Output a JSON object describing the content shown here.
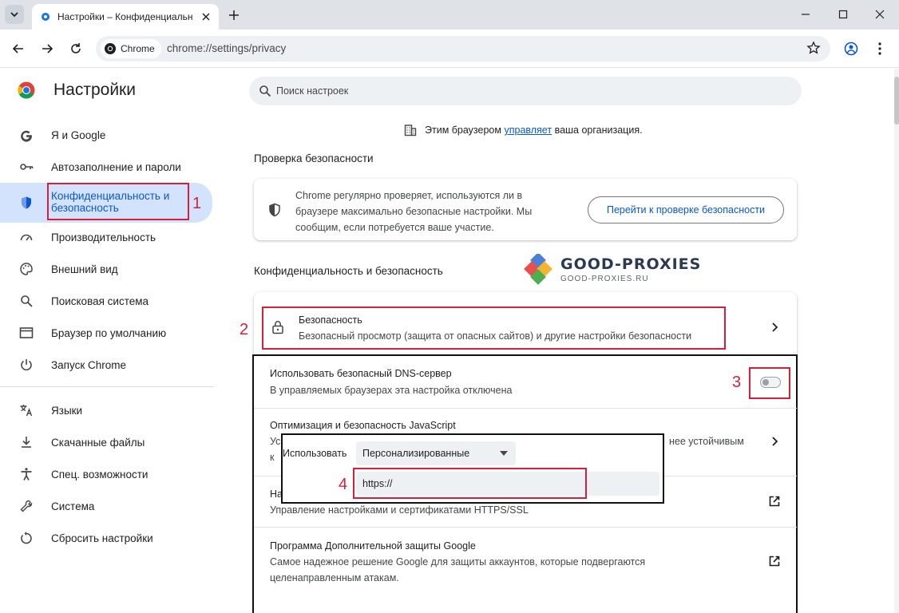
{
  "browser": {
    "tab_title": "Настройки – Конфиденциальность и безопасность",
    "chip_label": "Chrome",
    "url": "chrome://settings/privacy"
  },
  "sidebar": {
    "title": "Настройки",
    "items": [
      {
        "label": "Я и Google"
      },
      {
        "label": "Автозаполнение и пароли"
      },
      {
        "label_line1": "Конфиденциальность и",
        "label_line2": "безопасность"
      },
      {
        "label": "Производительность"
      },
      {
        "label": "Внешний вид"
      },
      {
        "label": "Поисковая система"
      },
      {
        "label": "Браузер по умолчанию"
      },
      {
        "label": "Запуск Chrome"
      },
      {
        "label": "Языки"
      },
      {
        "label": "Скачанные файлы"
      },
      {
        "label": "Спец. возможности"
      },
      {
        "label": "Система"
      },
      {
        "label": "Сбросить настройки"
      }
    ]
  },
  "search": {
    "placeholder": "Поиск настроек"
  },
  "managed": {
    "before": "Этим браузером",
    "link": "управляет",
    "after": "ваша организация."
  },
  "safety_check": {
    "heading": "Проверка безопасности",
    "text": "Chrome регулярно проверяет, используются ли в браузере максимально безопасные настройки. Мы сообщим, если потребуется ваше участие.",
    "button": "Перейти к проверке безопасности"
  },
  "privacy": {
    "heading": "Конфиденциальность и безопасность",
    "security_title": "Безопасность",
    "security_sub": "Безопасный просмотр (защита от опасных сайтов) и другие настройки безопасности",
    "dns_title": "Использовать безопасный DNS-сервер",
    "dns_sub": "В управляемых браузерах эта настройка отключена",
    "js_title": "Оптимизация и безопасность JavaScript",
    "js_sub_start": "Ус",
    "js_sub_end": "нее устойчивым",
    "js_sub_line2": "к",
    "certs_start": "На",
    "certs_sub": "Управление настройками и сертификатами HTTPS/SSL",
    "adv_title": "Программа Дополнительной защиты Google",
    "adv_sub_line1": "Самое надежное решение Google для защиты аккаунтов, которые подвергаются",
    "adv_sub_line2": "целенаправленным атакам."
  },
  "popup": {
    "use_label": "Использовать",
    "dropdown_value": "Персонализированные",
    "input_value": "https://"
  },
  "annotations": {
    "n1": "1",
    "n2": "2",
    "n3": "3",
    "n4": "4"
  },
  "watermark": {
    "brand": "GOOD-PROXIES",
    "sub": "GOOD-PROXIES.RU"
  },
  "colors": {
    "accent": "#0b57d0",
    "annotation": "#d4203d",
    "active_bg": "#d3e3fd"
  }
}
